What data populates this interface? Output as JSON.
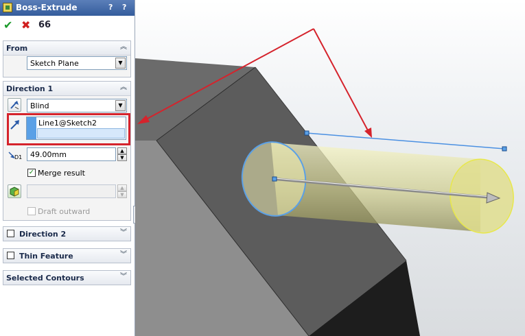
{
  "title": "Boss-Extrude",
  "header_buttons": {
    "help": "?",
    "pin": "?"
  },
  "actions": {
    "ok": "✔",
    "cancel": "✖",
    "preview": "66"
  },
  "groups": {
    "from": {
      "label": "From",
      "value": "Sketch Plane"
    },
    "direction1": {
      "label": "Direction 1",
      "end_condition": "Blind",
      "direction_reference": "Line1@Sketch2",
      "depth": "49.00mm",
      "depth_icon_label": "D1",
      "merge_result": {
        "label": "Merge result",
        "checked": true
      },
      "draft_outward": {
        "label": "Draft outward",
        "checked": false
      }
    },
    "direction2": {
      "label": "Direction 2",
      "checked": false
    },
    "thin_feature": {
      "label": "Thin Feature",
      "checked": false
    },
    "selected_contours": {
      "label": "Selected Contours"
    }
  },
  "colors": {
    "highlight": "#d5232c",
    "arrow": "#d5232c",
    "sketch_line": "#4a90e2",
    "preview": "#f4f3a4"
  }
}
